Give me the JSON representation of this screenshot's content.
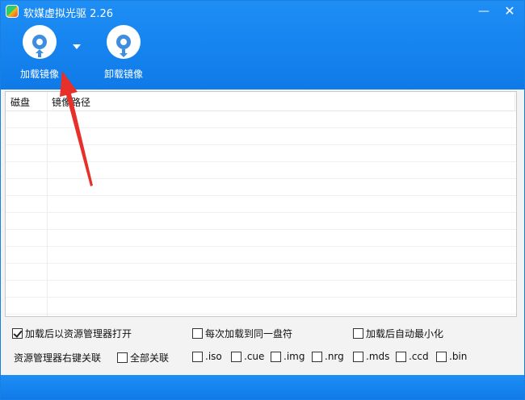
{
  "window": {
    "title": "软媒虚拟光驱 2.26",
    "minimize_glyph": "—",
    "close_glyph": "✕"
  },
  "toolbar": {
    "load_label": "加载镜像",
    "unload_label": "卸载镜像"
  },
  "list": {
    "columns": [
      "磁盘",
      "镜像路径"
    ],
    "rows": []
  },
  "options": {
    "open_explorer": {
      "label": "加载后以资源管理器打开",
      "checked": true
    },
    "same_drive": {
      "label": "每次加载到同一盘符",
      "checked": false
    },
    "minimize_after": {
      "label": "加载后自动最小化",
      "checked": false
    },
    "context_menu_label": "资源管理器右键关联",
    "all_assoc": {
      "label": "全部关联",
      "checked": false
    },
    "extensions": [
      {
        "label": ".iso",
        "checked": false
      },
      {
        "label": ".cue",
        "checked": false
      },
      {
        "label": ".img",
        "checked": false
      },
      {
        "label": ".nrg",
        "checked": false
      },
      {
        "label": ".mds",
        "checked": false
      },
      {
        "label": ".ccd",
        "checked": false
      },
      {
        "label": ".bin",
        "checked": false
      }
    ]
  },
  "colors": {
    "header": "#1e8ef5",
    "disc_accent": "#3d8de0",
    "annotation_arrow": "#e8302a"
  }
}
